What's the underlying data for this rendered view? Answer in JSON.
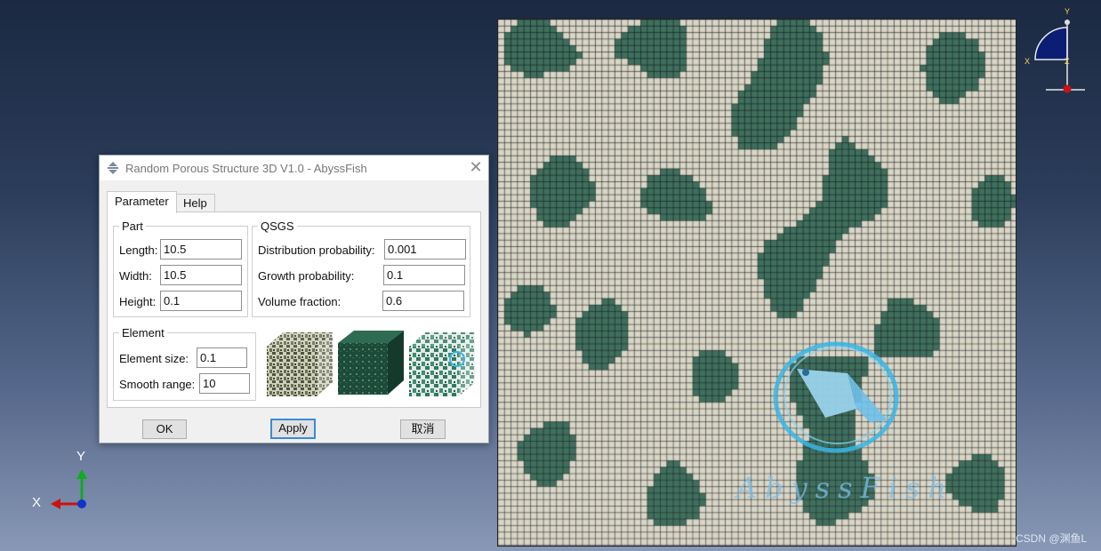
{
  "dialog": {
    "title": "Random Porous Structure 3D V1.0 - AbyssFish",
    "close_symbol": "✕",
    "tabs": [
      {
        "label": "Parameter"
      },
      {
        "label": "Help"
      }
    ],
    "part": {
      "legend": "Part",
      "length_label": "Length:",
      "length_value": "10.5",
      "width_label": "Width:",
      "width_value": "10.5",
      "height_label": "Height:",
      "height_value": "0.1"
    },
    "qsgs": {
      "legend": "QSGS",
      "distribution_label": "Distribution probability:",
      "distribution_value": "0.001",
      "growth_label": "Growth probability:",
      "growth_value": "0.1",
      "volume_label": "Volume fraction:",
      "volume_value": "0.6"
    },
    "element": {
      "legend": "Element",
      "size_label": "Element size:",
      "size_value": "0.1",
      "smooth_label": "Smooth range:",
      "smooth_value": "10"
    },
    "buttons": {
      "ok": "OK",
      "apply": "Apply",
      "cancel": "取消"
    }
  },
  "viewport": {
    "triad_y": "Y",
    "triad_x": "X",
    "view_cube_y": "Y",
    "view_cube_x": "X",
    "view_cube_z": "Z",
    "watermark_text": "AbyssFish",
    "credit": "CSDN @渊鱼L"
  },
  "colors": {
    "mesh_light": "#d9d6c6",
    "mesh_dark": "#3f6f5d",
    "mesh_line": "#111111",
    "axis_x": "#cc1111",
    "axis_y": "#11aa22",
    "axis_z": "#1133cc"
  },
  "icons": [
    "abaqus-plugin-icon",
    "close-icon",
    "axis-triad-icon",
    "view-cube-icon",
    "abyssfish-logo-icon"
  ]
}
